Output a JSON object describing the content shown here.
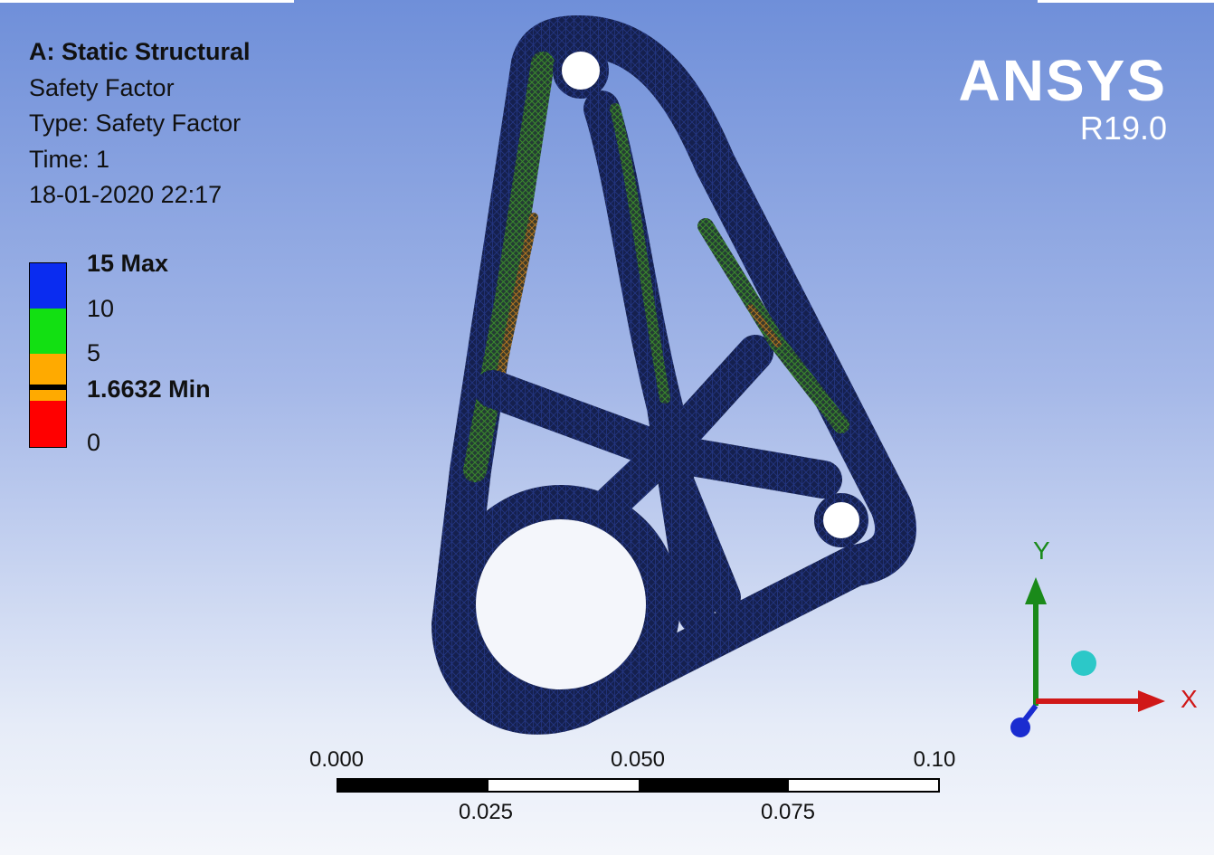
{
  "info": {
    "title": "A: Static Structural",
    "result": "Safety Factor",
    "type_line": "Type: Safety Factor",
    "time_line": "Time: 1",
    "timestamp": "18-01-2020 22:17"
  },
  "legend": {
    "max_label": "15 Max",
    "l10": "10",
    "l5": "5",
    "min_label": "1.6632 Min",
    "l0": "0",
    "colors": {
      "blue": "#0a2cf0",
      "green": "#12e012",
      "orange": "#ffaa00",
      "red": "#ff0000"
    }
  },
  "brand": {
    "name": "ANSYS",
    "version": "R19.0"
  },
  "triad": {
    "x_label": "X",
    "y_label": "Y"
  },
  "scale_bar": {
    "top_labels": [
      "0.000",
      "0.050",
      "0.10"
    ],
    "bottom_labels": [
      "0.025",
      "0.075"
    ]
  }
}
